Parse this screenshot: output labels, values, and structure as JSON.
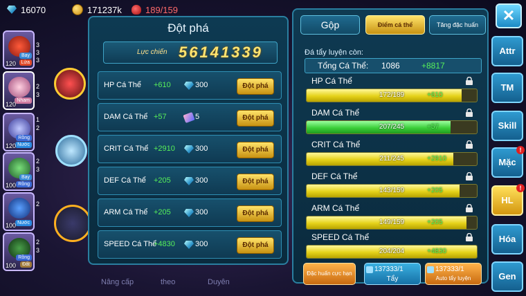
{
  "resources": {
    "gems": "16070",
    "coins": "171237k",
    "food": "189/159"
  },
  "left_list": {
    "pokemon": [
      {
        "level": "120",
        "tags": [
          "Bay",
          "Lửa"
        ],
        "side": [
          "3",
          "3",
          "3"
        ]
      },
      {
        "level": "120",
        "tags": [
          "Nham"
        ],
        "side": [
          "2",
          "3"
        ]
      },
      {
        "level": "120",
        "tags": [
          "Rồng",
          "Nước"
        ],
        "side": [
          "1",
          "2"
        ]
      },
      {
        "level": "100",
        "tags": [
          "Bay",
          "Rồng"
        ],
        "side": [
          "2",
          "3"
        ]
      },
      {
        "level": "100",
        "tags": [
          "Nước"
        ],
        "side": [
          "2"
        ]
      },
      {
        "level": "100",
        "tags": [
          "Rồng",
          "Đất"
        ],
        "side": [
          "2",
          "3"
        ]
      }
    ]
  },
  "background_menu": [
    "Nâng cấp",
    "theo",
    "Duyên"
  ],
  "breakthrough": {
    "title": "Đột phá",
    "power_label": "Lực chiến",
    "power_value": "56141339",
    "button_label": "Đột phá",
    "rows": [
      {
        "name": "HP Cá Thể",
        "bonus": "+610",
        "cost": "300",
        "cost_icon": "gem-icon"
      },
      {
        "name": "DAM Cá Thể",
        "bonus": "+57",
        "cost": "5",
        "cost_icon": "scroll-icon"
      },
      {
        "name": "CRIT Cá Thể",
        "bonus": "+2910",
        "cost": "300",
        "cost_icon": "gem-icon"
      },
      {
        "name": "DEF Cá Thể",
        "bonus": "+205",
        "cost": "300",
        "cost_icon": "gem-icon"
      },
      {
        "name": "ARM Cá Thể",
        "bonus": "+205",
        "cost": "300",
        "cost_icon": "gem-icon"
      },
      {
        "name": "SPEED Cá Thể",
        "bonus": "+4830",
        "cost": "300",
        "cost_icon": "gem-icon"
      }
    ]
  },
  "training": {
    "tabs": {
      "merge": "Gộp",
      "individual": "Điểm cá thể",
      "special": "Tăng đặc huấn"
    },
    "remaining_label": "Đá tẩy luyện còn:",
    "total_label": "Tổng Cá Thể:",
    "total_value": "1086",
    "total_bonus": "+8817",
    "stats": [
      {
        "name": "HP Cá Thể",
        "value": "172/189",
        "bonus": "+610",
        "fill": 0.91,
        "color": "yellow"
      },
      {
        "name": "DAM Cá Thể",
        "value": "207/245",
        "bonus": "+57",
        "fill": 0.845,
        "color": "green"
      },
      {
        "name": "CRIT Cá Thể",
        "value": "211/245",
        "bonus": "+2910",
        "fill": 0.861,
        "color": "yellow"
      },
      {
        "name": "DEF Cá Thể",
        "value": "143/159",
        "bonus": "+205",
        "fill": 0.899,
        "color": "yellow"
      },
      {
        "name": "ARM Cá Thể",
        "value": "149/159",
        "bonus": "+205",
        "fill": 0.937,
        "color": "yellow"
      },
      {
        "name": "SPEED Cá Thể",
        "value": "204/204",
        "bonus": "+4830",
        "fill": 1.0,
        "color": "yellow"
      }
    ],
    "buttons": {
      "special_training": "Đặc huấn cực hạn",
      "wash_count": "137333/1",
      "wash_label": "Tẩy",
      "auto_count": "137333/1",
      "auto_label": "Auto tẩy luyện"
    }
  },
  "side_menu": [
    {
      "label": "Attr",
      "alert": false,
      "selected": false
    },
    {
      "label": "TM",
      "alert": false,
      "selected": false
    },
    {
      "label": "Skill",
      "alert": false,
      "selected": false
    },
    {
      "label": "Mặc",
      "alert": true,
      "selected": false
    },
    {
      "label": "HL",
      "alert": true,
      "selected": true
    },
    {
      "label": "Hóa",
      "alert": false,
      "selected": false
    },
    {
      "label": "Gen",
      "alert": false,
      "selected": false
    }
  ],
  "close_label": "✕",
  "colors": {
    "gold": "#ffe470",
    "green_text": "#57f05a",
    "panel": "#0f3a52",
    "border": "#2a7fa0"
  }
}
